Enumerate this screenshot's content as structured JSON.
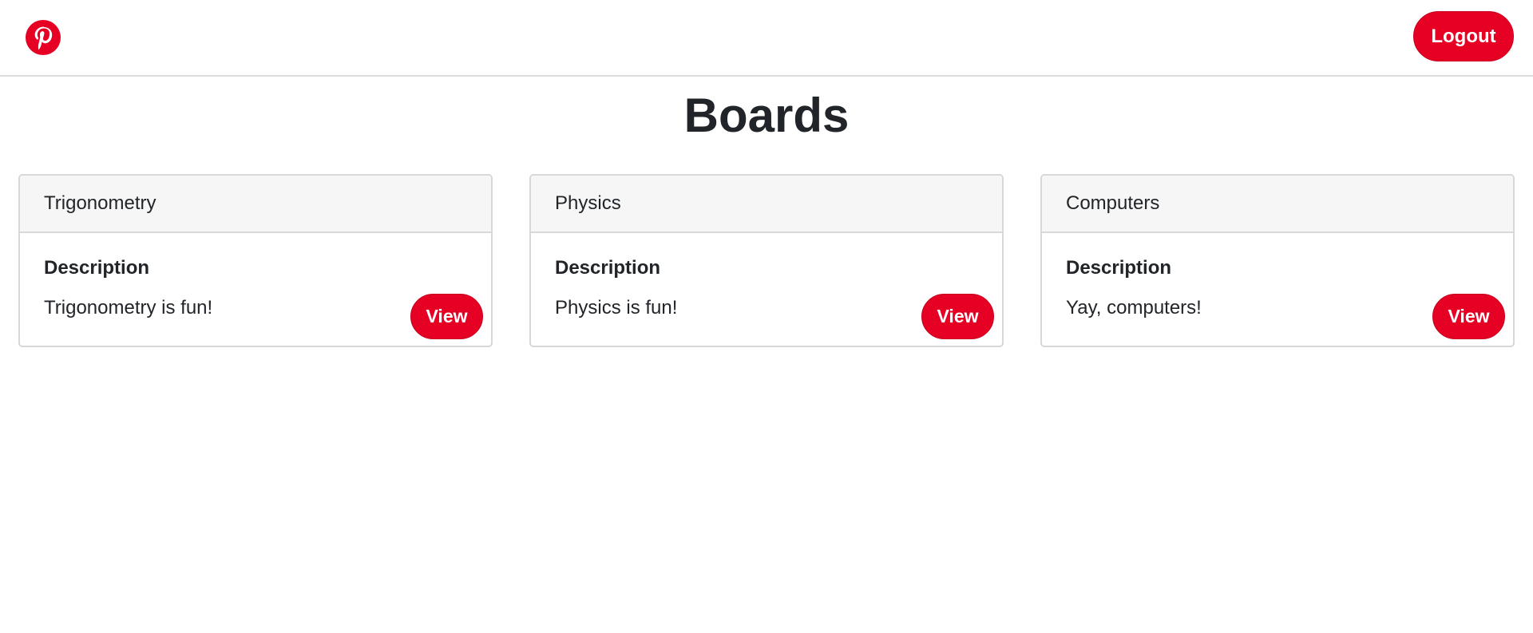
{
  "header": {
    "logo_icon": "pinterest-logo-icon",
    "logout_label": "Logout"
  },
  "page": {
    "title": "Boards"
  },
  "boards": [
    {
      "name": "Trigonometry",
      "desc_heading": "Description",
      "description": "Trigonometry is fun!",
      "view_label": "View"
    },
    {
      "name": "Physics",
      "desc_heading": "Description",
      "description": "Physics is fun!",
      "view_label": "View"
    },
    {
      "name": "Computers",
      "desc_heading": "Description",
      "description": "Yay, computers!",
      "view_label": "View"
    }
  ],
  "colors": {
    "brand": "#e60023",
    "header_bg": "#f6f6f6",
    "border": "#d8d8d8",
    "text": "#212529"
  }
}
